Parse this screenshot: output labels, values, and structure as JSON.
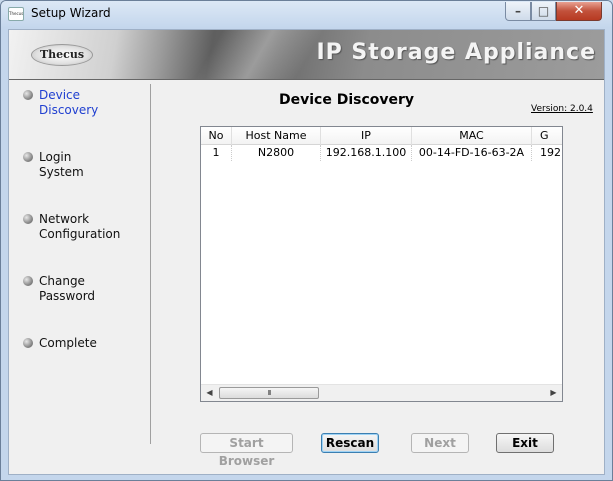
{
  "window": {
    "title": "Setup Wizard",
    "app_icon_text": "Thecus"
  },
  "banner": {
    "logo": "Thecus",
    "title": "IP Storage Appliance"
  },
  "sidebar": {
    "items": [
      {
        "line1": "Device",
        "line2": "Discovery"
      },
      {
        "line1": "Login",
        "line2": "System"
      },
      {
        "line1": "Network",
        "line2": "Configuration"
      },
      {
        "line1": "Change",
        "line2": "Password"
      },
      {
        "line1": "Complete",
        "line2": ""
      }
    ]
  },
  "main": {
    "title": "Device Discovery",
    "version": "Version: 2.0.4",
    "table": {
      "columns": [
        "No",
        "Host Name",
        "IP",
        "MAC",
        "G"
      ],
      "rows": [
        [
          "1",
          "N2800",
          "192.168.1.100",
          "00-14-FD-16-63-2A",
          "192"
        ]
      ]
    },
    "scroll_thumb": "III"
  },
  "buttons": {
    "start_browser": "Start Browser",
    "rescan": "Rescan",
    "next": "Next",
    "exit": "Exit"
  },
  "colors": {
    "active_nav": "#1f3fd0",
    "close_button": "#c2513b"
  }
}
